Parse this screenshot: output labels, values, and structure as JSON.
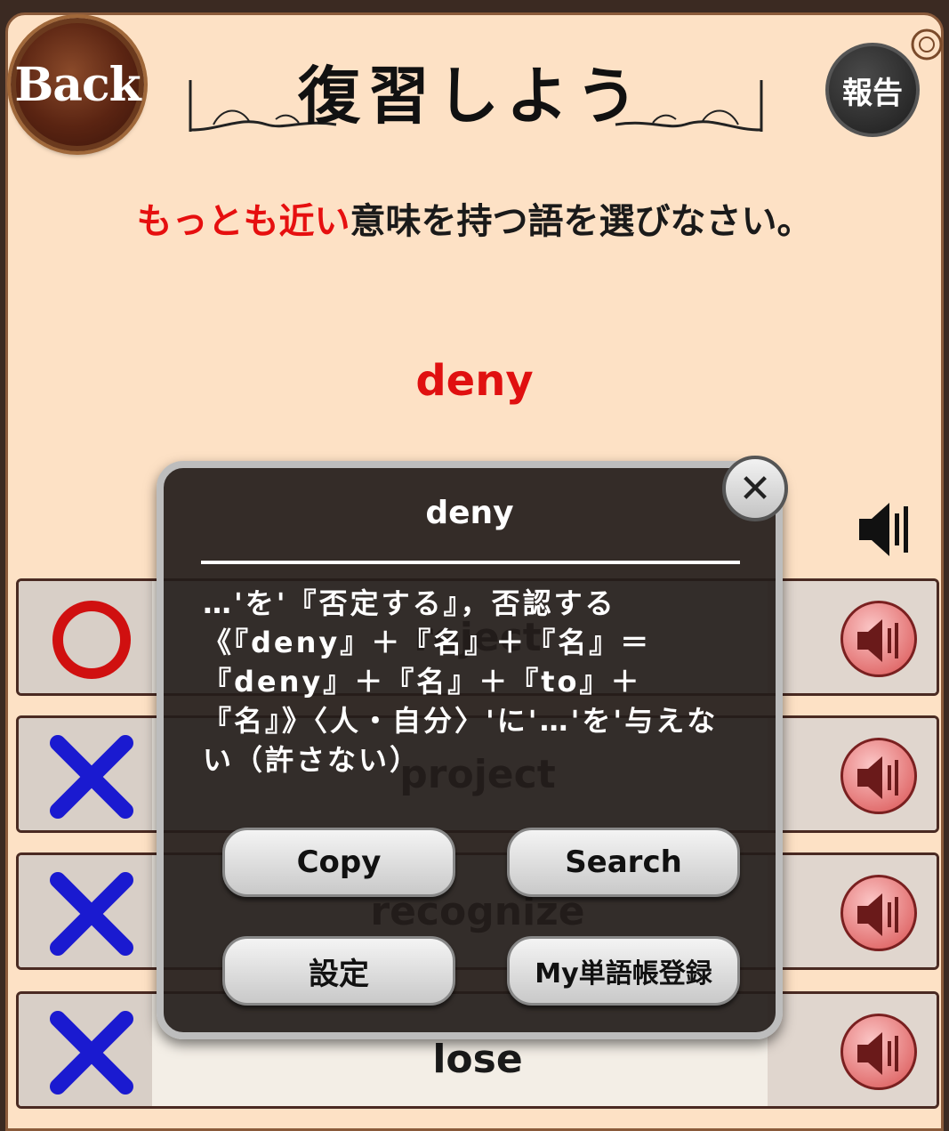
{
  "header": {
    "back_label": "Back",
    "title": "復習しよう",
    "report_label": "報告"
  },
  "instruction": {
    "highlight": "もっとも近い",
    "rest": "意味を持つ語を選びなさい。"
  },
  "question": {
    "word": "deny"
  },
  "choices": [
    {
      "label": "reject",
      "result": "correct",
      "mark_icon": "circle-icon"
    },
    {
      "label": "project",
      "result": "wrong",
      "mark_icon": "cross-icon"
    },
    {
      "label": "recognize",
      "result": "wrong",
      "mark_icon": "cross-icon"
    },
    {
      "label": "lose",
      "result": "wrong",
      "mark_icon": "cross-icon"
    }
  ],
  "popup": {
    "title": "deny",
    "definition": "…'を'『否定する』，否認する《『deny』＋『名』＋『名』＝『deny』＋『名』＋『to』＋『名』》〈人・自分〉'に'…'を'与えない（許さない）",
    "buttons": {
      "copy": "Copy",
      "search": "Search",
      "settings": "設定",
      "my_wordbook": "My単語帳登録"
    },
    "close_icon": "close-icon"
  },
  "colors": {
    "highlight_red": "#e60f0f",
    "background": "#fde1c5",
    "correct_mark": "#d01010",
    "wrong_mark": "#1a1ad0"
  }
}
